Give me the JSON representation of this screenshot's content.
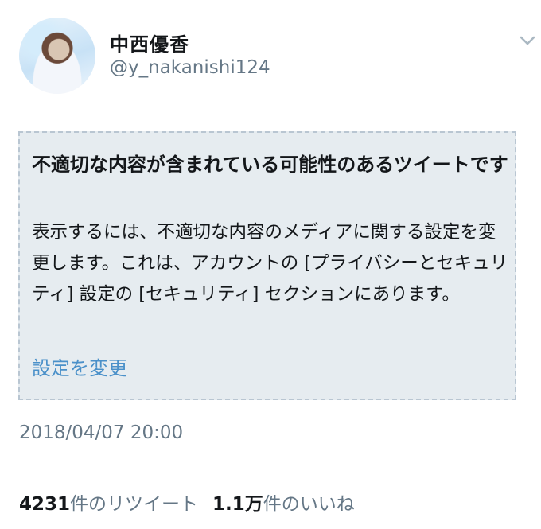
{
  "profile": {
    "display_name": "中西優香",
    "handle": "@y_nakanishi124",
    "avatar_icon": "avatar-photo"
  },
  "menu": {
    "icon": "chevron-down-icon",
    "color": "#aab8c2"
  },
  "sensitive_notice": {
    "title": "不適切な内容が含まれている可能性のあるツイートです",
    "body": "表示するには、不適切な内容のメディアに関する設定を変更します。これは、アカウントの [プライバシーとセキュリティ] 設定の [セキュリティ] セクションにあります。",
    "link": "設定を変更",
    "link_color": "#4a90c9",
    "background": "#e6ecf0"
  },
  "timestamp": "2018/04/07 20:00",
  "stats": {
    "retweets_count": "4231",
    "retweets_label": "件のリツイート",
    "likes_count": "1.1万",
    "likes_label": "件のいいね"
  }
}
